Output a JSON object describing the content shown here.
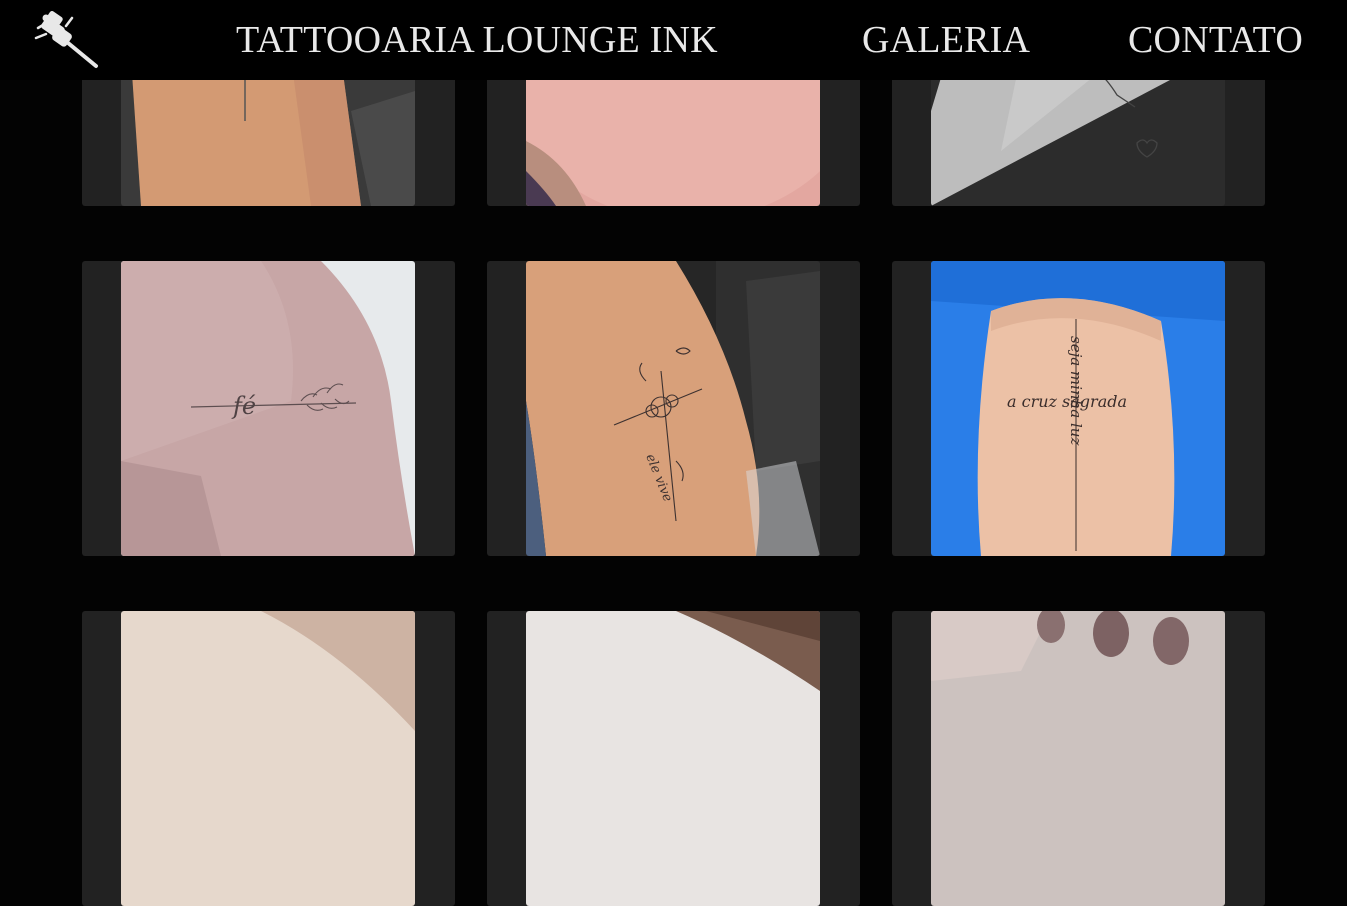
{
  "navbar": {
    "logo_icon": "tattoo-machine-icon",
    "brand": "TATTOOARIA LOUNGE INK",
    "links": [
      "GALERIA",
      "CONTATO"
    ]
  },
  "gallery": {
    "images": [
      {
        "subject": "forearm-cross-tattoo"
      },
      {
        "subject": "shoulder-script-tattoo"
      },
      {
        "subject": "arm-script-heart-tattoo"
      },
      {
        "subject": "shoulder-fe-branch-tattoo"
      },
      {
        "subject": "forearm-floral-cross-tattoo",
        "script": "ele vive"
      },
      {
        "subject": "arm-script-cross-tattoo",
        "script_h": "a cruz sagrada",
        "script_v": "seja minha luz"
      },
      {
        "subject": "skin-photo"
      },
      {
        "subject": "hand-photo"
      },
      {
        "subject": "hands-nails-photo"
      }
    ]
  },
  "tattoo_text": {
    "fe": "fé",
    "cruz_h": "a cruz sagrada",
    "cruz_v": "seja minha luz",
    "ele_vive": "ele vive"
  },
  "colors": {
    "background": "#030303",
    "card": "#222222",
    "nav_text": "#e9e9e9",
    "skin_tan": "#d8a07a",
    "skin_pale": "#bf9f9f",
    "shirt_blue": "#2a7ee8"
  }
}
